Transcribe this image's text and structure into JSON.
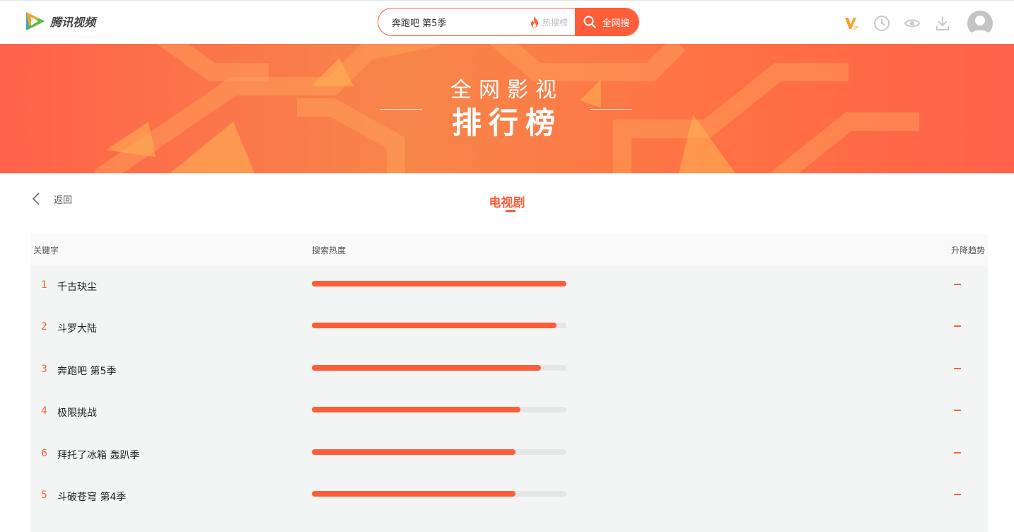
{
  "header": {
    "logo_text": "腾讯视频",
    "search_value": "奔跑吧 第5季",
    "hot_label": "热搜榜",
    "search_button": "全网搜",
    "vip_label": "VIP"
  },
  "banner": {
    "line1": "全网影视",
    "line2": "排行榜"
  },
  "nav": {
    "back_label": "返回",
    "category": "电视剧"
  },
  "table": {
    "headers": [
      "关键字",
      "搜索热度",
      "升降趋势"
    ],
    "rows": [
      {
        "rank": "1",
        "keyword": "千古玦尘",
        "heat": 1.0,
        "trend": "–"
      },
      {
        "rank": "2",
        "keyword": "斗罗大陆",
        "heat": 0.96,
        "trend": "–"
      },
      {
        "rank": "3",
        "keyword": "奔跑吧 第5季",
        "heat": 0.9,
        "trend": "–"
      },
      {
        "rank": "4",
        "keyword": "极限挑战",
        "heat": 0.82,
        "trend": "–"
      },
      {
        "rank": "6",
        "keyword": "拜托了冰箱 轰趴季",
        "heat": 0.8,
        "trend": "–"
      },
      {
        "rank": "5",
        "keyword": "斗破苍穹 第4季",
        "heat": 0.8,
        "trend": "–"
      }
    ]
  },
  "colors": {
    "accent": "#ff5c38",
    "banner": "#ff6a48",
    "row_bg": "#f3f5f4"
  }
}
